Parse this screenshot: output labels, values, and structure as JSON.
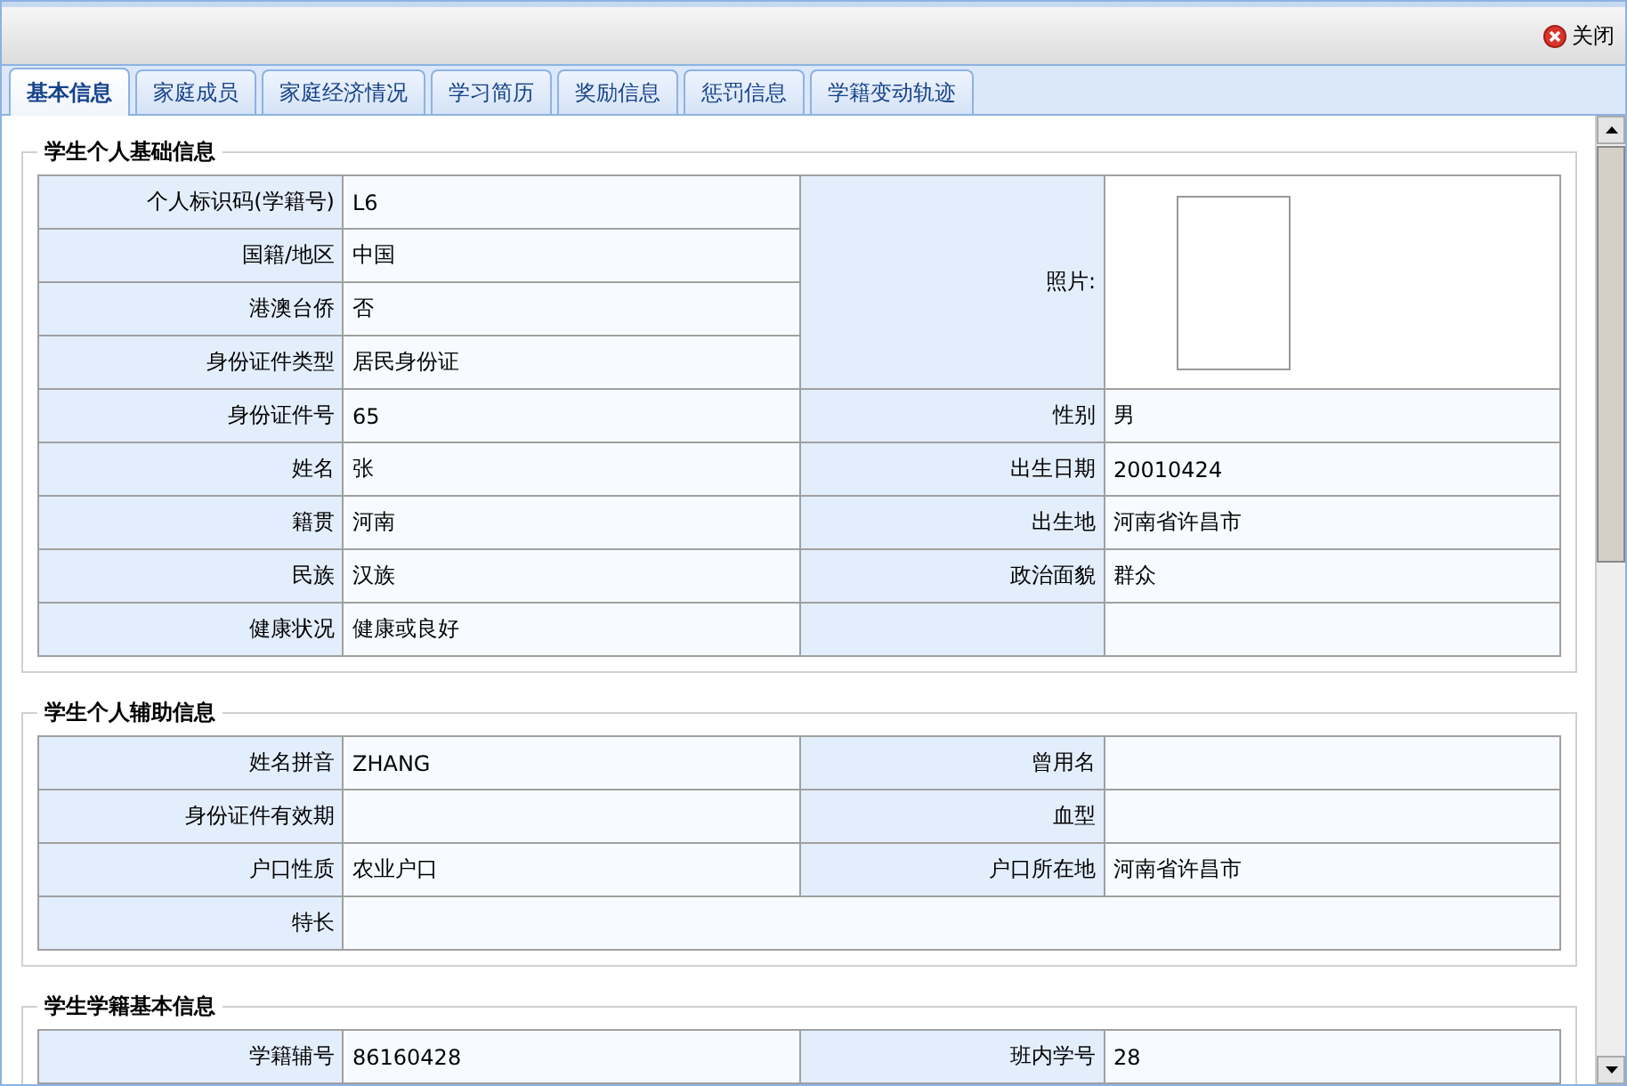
{
  "toolbar": {
    "close_button": "关闭"
  },
  "tabs": [
    {
      "label": "基本信息",
      "selected": true
    },
    {
      "label": "家庭成员",
      "selected": false
    },
    {
      "label": "家庭经济情况",
      "selected": false
    },
    {
      "label": "学习简历",
      "selected": false
    },
    {
      "label": "奖励信息",
      "selected": false
    },
    {
      "label": "惩罚信息",
      "selected": false
    },
    {
      "label": "学籍变动轨迹",
      "selected": false
    }
  ],
  "sections": [
    {
      "title": "学生个人基础信息",
      "photo": {
        "label": "照片:"
      },
      "rows": [
        {
          "kind": "pair",
          "left": {
            "label": "个人标识码(学籍号)",
            "value": "L6"
          }
        },
        {
          "kind": "pair",
          "left": {
            "label": "国籍/地区",
            "value": "中国"
          }
        },
        {
          "kind": "pair",
          "left": {
            "label": "港澳台侨",
            "value": "否"
          }
        },
        {
          "kind": "pair",
          "left": {
            "label": "身份证件类型",
            "value": "居民身份证"
          }
        },
        {
          "kind": "pair",
          "left": {
            "label": "身份证件号",
            "value": "65"
          },
          "right": {
            "label": "性别",
            "value": "男"
          }
        },
        {
          "kind": "pair",
          "left": {
            "label": "姓名",
            "value": "张"
          },
          "right": {
            "label": "出生日期",
            "value": "20010424"
          }
        },
        {
          "kind": "pair",
          "left": {
            "label": "籍贯",
            "value": "河南"
          },
          "right": {
            "label": "出生地",
            "value": "河南省许昌市"
          }
        },
        {
          "kind": "pair",
          "left": {
            "label": "民族",
            "value": "汉族"
          },
          "right": {
            "label": "政治面貌",
            "value": "群众"
          }
        },
        {
          "kind": "pair",
          "left": {
            "label": "健康状况",
            "value": "健康或良好"
          },
          "right": {}
        }
      ]
    },
    {
      "title": "学生个人辅助信息",
      "rows": [
        {
          "kind": "pair",
          "left": {
            "label": "姓名拼音",
            "value": "ZHANG"
          },
          "right": {
            "label": "曾用名"
          }
        },
        {
          "kind": "pair",
          "left": {
            "label": "身份证件有效期"
          },
          "right": {
            "label": "血型"
          }
        },
        {
          "kind": "pair",
          "left": {
            "label": "户口性质",
            "value": "农业户口"
          },
          "right": {
            "label": "户口所在地",
            "value": "河南省许昌市"
          }
        },
        {
          "kind": "wide",
          "left": {
            "label": "特长"
          }
        }
      ]
    },
    {
      "title": "学生学籍基本信息",
      "rows": [
        {
          "kind": "pair",
          "left": {
            "label": "学籍辅号",
            "value": "86160428"
          },
          "right": {
            "label": "班内学号",
            "value": "28"
          }
        }
      ]
    }
  ]
}
